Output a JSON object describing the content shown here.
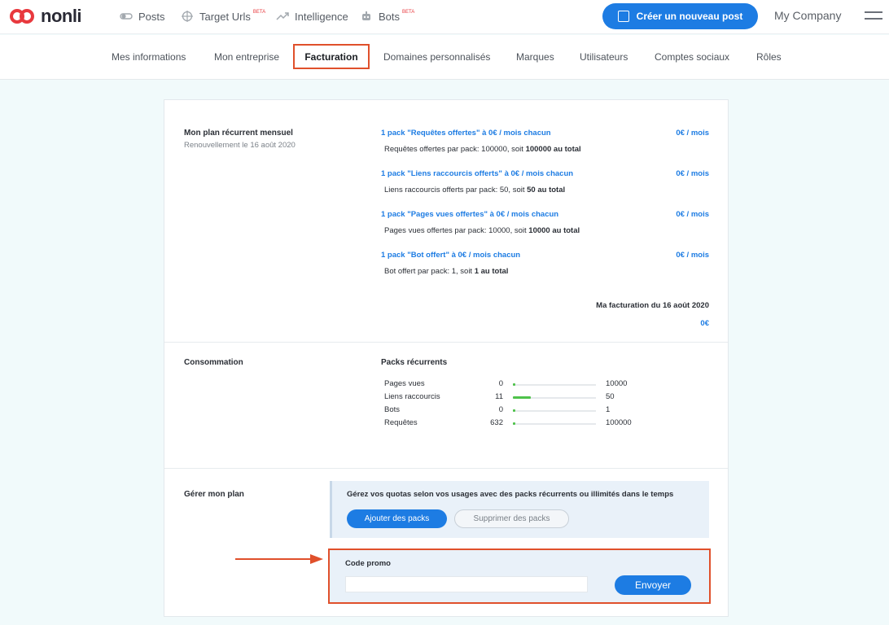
{
  "brand": {
    "name": "nonli"
  },
  "nav": [
    {
      "label": "Posts",
      "badge": ""
    },
    {
      "label": "Target Urls",
      "badge": "BETA"
    },
    {
      "label": "Intelligence",
      "badge": ""
    },
    {
      "label": "Bots",
      "badge": "BETA"
    }
  ],
  "header": {
    "create_label": "Créer un nouveau post",
    "company": "My Company"
  },
  "tabs": [
    "Mes informations",
    "Mon entreprise",
    "Facturation",
    "Domaines personnalisés",
    "Marques",
    "Utilisateurs",
    "Comptes sociaux",
    "Rôles"
  ],
  "plan": {
    "title": "Mon plan récurrent mensuel",
    "renewal": "Renouvellement le 16 août 2020",
    "packs": [
      {
        "title": "1 pack \"Requêtes offertes\" à 0€ / mois chacun",
        "price": "0€ / mois",
        "detail_prefix": "Requêtes offertes par pack: 100000, soit ",
        "detail_total": "100000 au total"
      },
      {
        "title": "1 pack \"Liens raccourcis offerts\" à 0€ / mois chacun",
        "price": "0€ / mois",
        "detail_prefix": "Liens raccourcis offerts par pack: 50, soit ",
        "detail_total": "50 au total"
      },
      {
        "title": "1 pack \"Pages vues offertes\" à 0€ / mois chacun",
        "price": "0€ / mois",
        "detail_prefix": "Pages vues offertes par pack: 10000, soit ",
        "detail_total": "10000 au total"
      },
      {
        "title": "1 pack \"Bot offert\" à 0€ / mois chacun",
        "price": "0€ / mois",
        "detail_prefix": "Bot offert par pack: 1, soit ",
        "detail_total": "1 au total"
      }
    ],
    "billing_label": "Ma facturation du 16 août 2020",
    "billing_amount": "0€"
  },
  "consumption": {
    "title": "Consommation",
    "subtitle": "Packs récurrents",
    "rows": [
      {
        "name": "Pages vues",
        "used": "0",
        "max": "10000",
        "ratio": 0
      },
      {
        "name": "Liens raccourcis",
        "used": "11",
        "max": "50",
        "ratio": 0.22
      },
      {
        "name": "Bots",
        "used": "0",
        "max": "1",
        "ratio": 0
      },
      {
        "name": "Requêtes",
        "used": "632",
        "max": "100000",
        "ratio": 0.00632
      }
    ]
  },
  "manage": {
    "title": "Gérer mon plan",
    "text": "Gérez vos quotas selon vos usages avec des packs récurrents ou illimités dans le temps",
    "add_label": "Ajouter des packs",
    "remove_label": "Supprimer des packs"
  },
  "promo": {
    "label": "Code promo",
    "value": "",
    "send_label": "Envoyer"
  },
  "colors": {
    "accent": "#1d7ce3",
    "highlight": "#e0502b",
    "progress": "#4fc24b",
    "brand": "#e8393e"
  }
}
